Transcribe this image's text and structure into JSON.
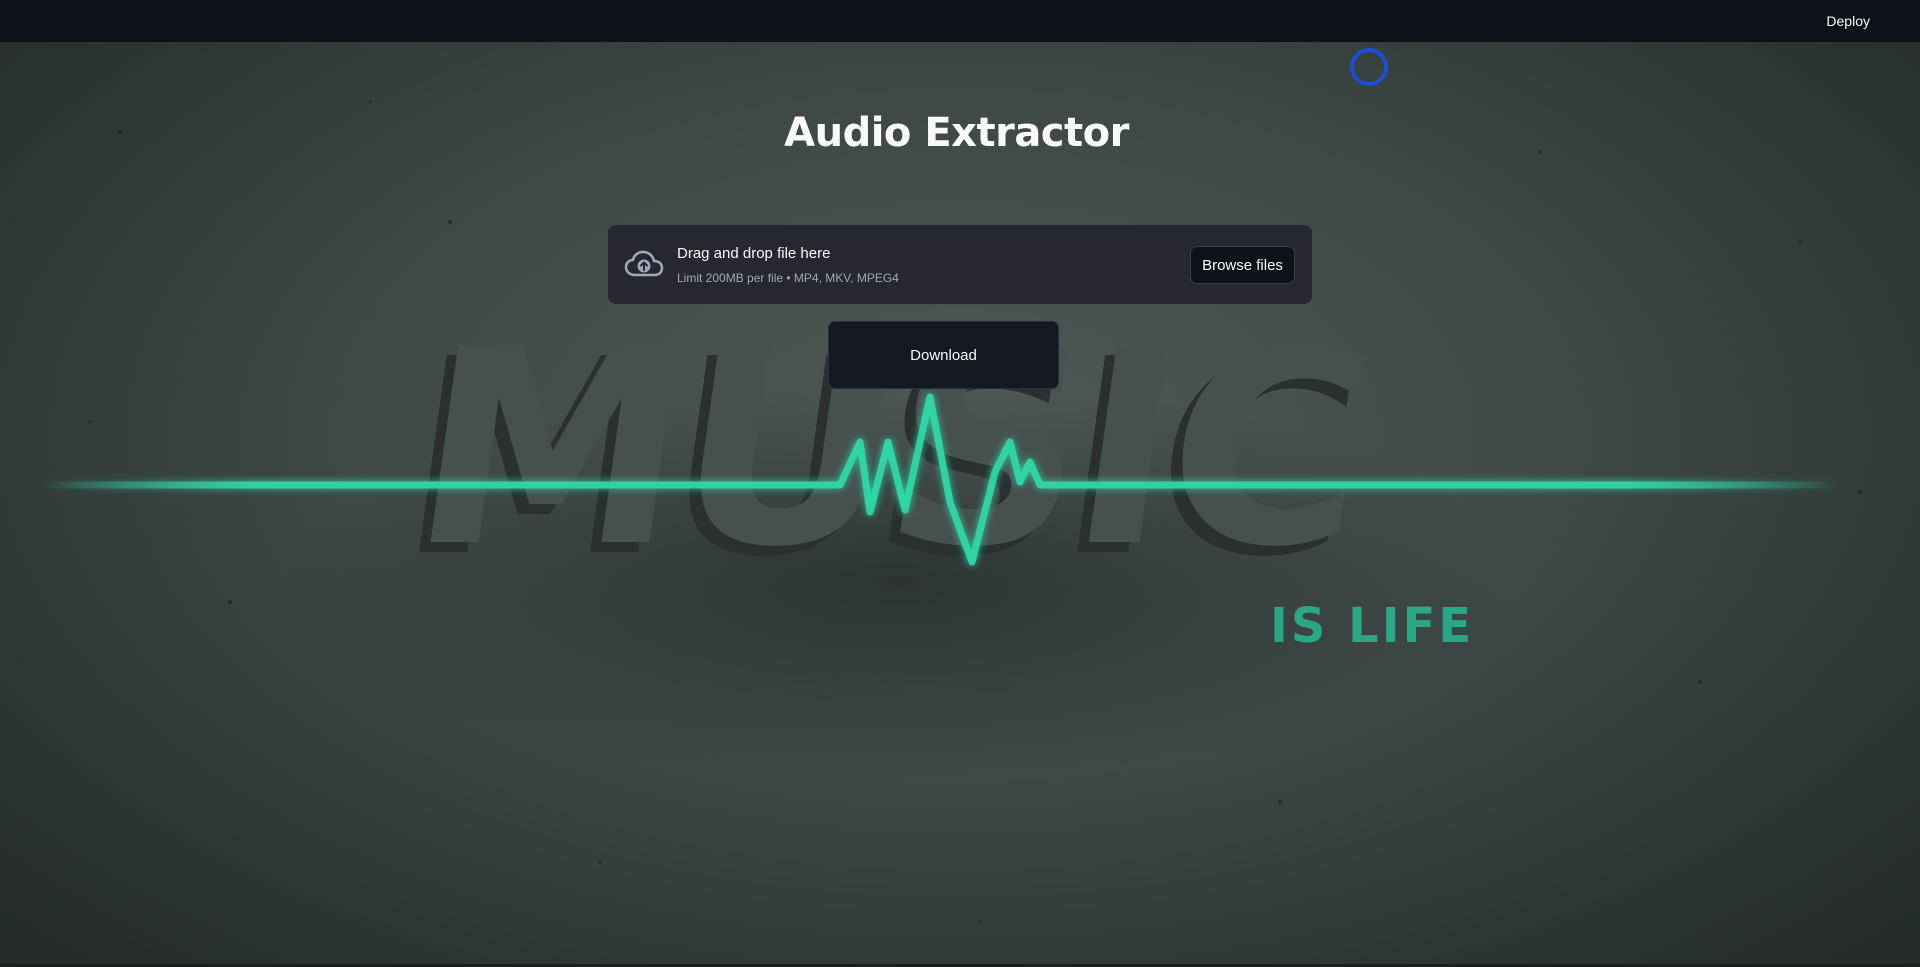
{
  "header": {
    "deploy_label": "Deploy"
  },
  "main": {
    "title": "Audio Extractor",
    "uploader": {
      "title": "Drag and drop file here",
      "limit_text": "Limit 200MB per file • MP4, MKV, MPEG4",
      "browse_label": "Browse files",
      "icon": "cloud-upload-icon"
    },
    "download_label": "Download"
  },
  "background": {
    "art_word": "MUSIC",
    "art_tagline": "IS LIFE",
    "accent_color": "#2fd9a8"
  },
  "colors": {
    "header_bg": "#0e1117",
    "uploader_bg": "#262730",
    "spinner": "#1d4ed8"
  }
}
